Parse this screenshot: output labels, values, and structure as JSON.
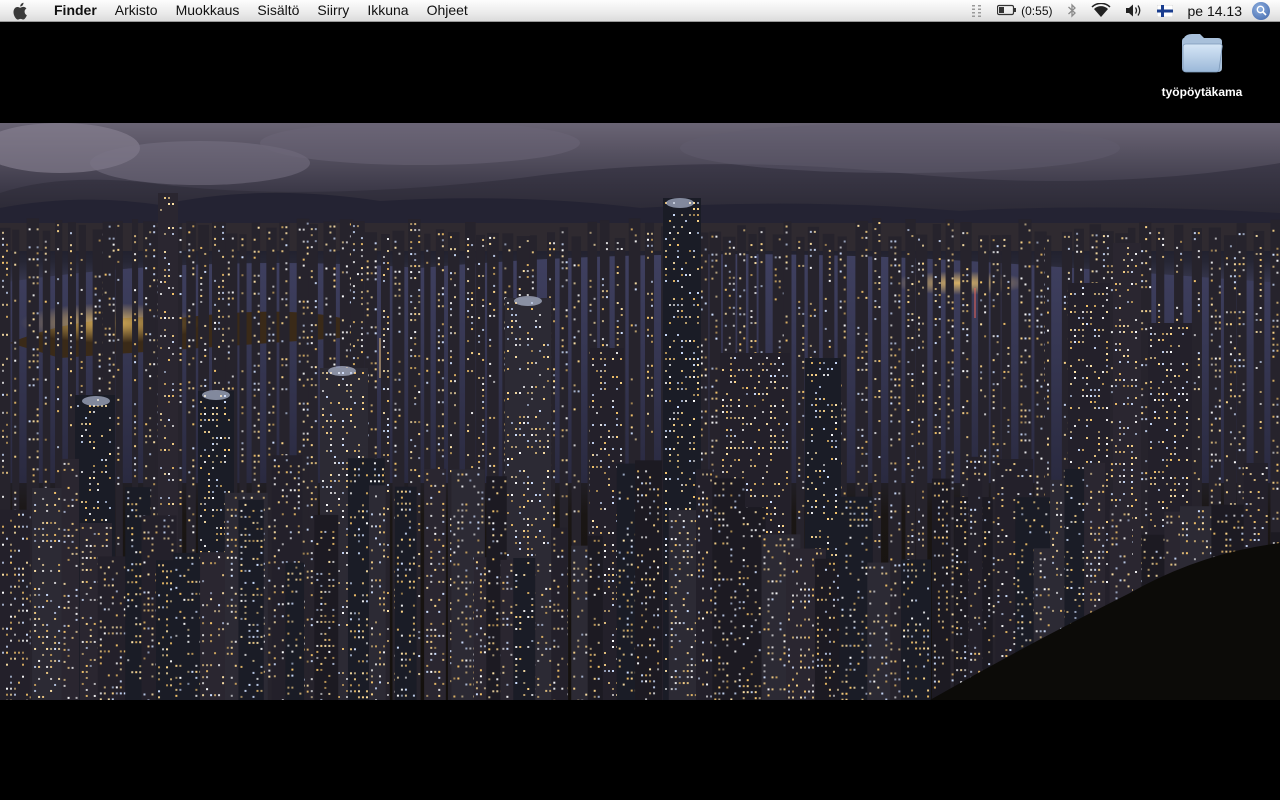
{
  "menubar": {
    "apple_icon": "apple-icon",
    "app_name": "Finder",
    "menus": [
      "Arkisto",
      "Muokkaus",
      "Sisältö",
      "Siirry",
      "Ikkuna",
      "Ohjeet"
    ],
    "status": {
      "battery_text": "(0:55)",
      "clock": "pe 14.13",
      "icons": [
        "resize-grip-icon",
        "battery-icon",
        "bluetooth-icon",
        "wifi-icon",
        "volume-icon",
        "finnish-flag-icon",
        "spotlight-icon"
      ]
    }
  },
  "desktop": {
    "items": [
      {
        "label": "työpöytäkama",
        "icon": "folder-icon"
      }
    ],
    "wallpaper": "night city skyline panorama"
  },
  "colors": {
    "background": "#000000",
    "menubar_top": "#fdfdfd",
    "menubar_bottom": "#dcdcdc"
  }
}
